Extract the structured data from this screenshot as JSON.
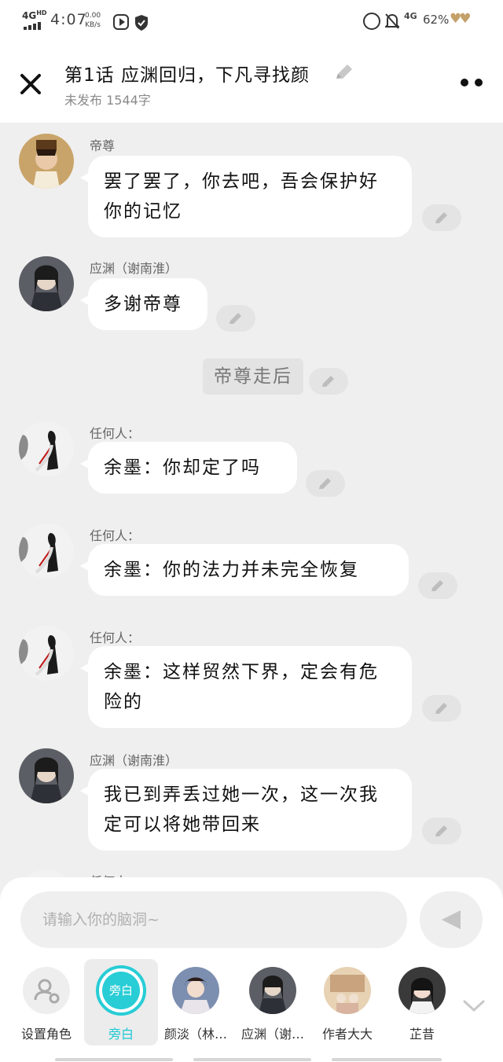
{
  "status_bar": {
    "network": "4G",
    "network_sup": "HD",
    "time": "4:07",
    "speed_value": "0.00",
    "speed_unit": "KB/s",
    "network_right": "4G",
    "battery": "62%"
  },
  "header": {
    "title": "第1话  应渊回归，下凡寻找颜",
    "subtitle": "未发布 1544字"
  },
  "messages": [
    {
      "sender": "帝尊",
      "text": "罢了罢了，你去吧，吾会保护好你的记忆"
    },
    {
      "sender": "应渊（谢南淮）",
      "text": "多谢帝尊"
    },
    {
      "narration": "帝尊走后"
    },
    {
      "sender": "任何人：",
      "text": "余墨：你却定了吗"
    },
    {
      "sender": "任何人：",
      "text": "余墨：你的法力并未完全恢复"
    },
    {
      "sender": "任何人：",
      "text": "余墨：这样贸然下界，定会有危险的"
    },
    {
      "sender": "应渊（谢南淮）",
      "text": "我已到弄丢过她一次，这一次我定可以将她带回来"
    },
    {
      "sender": "任何人："
    }
  ],
  "composer": {
    "placeholder": "请输入你的脑洞~"
  },
  "roles": [
    {
      "label": "设置角色",
      "icon": "add-role-icon"
    },
    {
      "label": "旁白",
      "badge": "旁白",
      "active": true
    },
    {
      "label": "颜淡（林…"
    },
    {
      "label": "应渊（谢…"
    },
    {
      "label": "作者大大"
    },
    {
      "label": "芷昔"
    }
  ],
  "colors": {
    "accent": "#28cdd6",
    "background": "#efefef",
    "bubble": "#ffffff"
  }
}
